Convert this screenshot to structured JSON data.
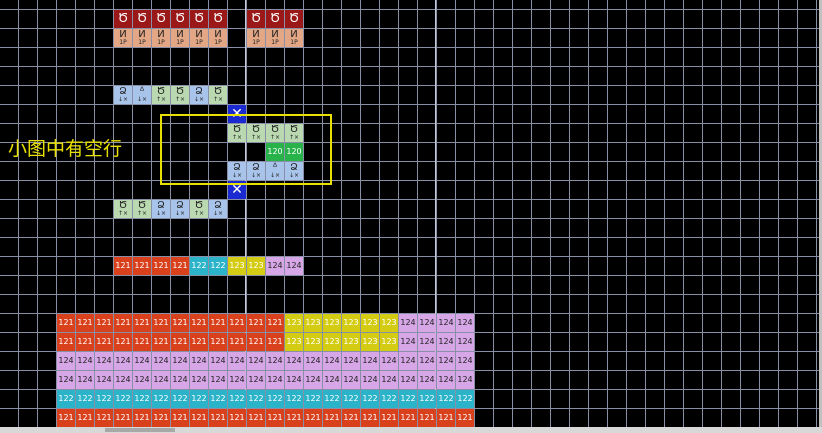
{
  "colors": {
    "grid_line": "#8a8fa8",
    "grid_major": "#c8ccd8",
    "c121": "#d9401c",
    "c122": "#2bb3c9",
    "c123": "#d4cc12",
    "c124": "#d6a6e6",
    "c120": "#27b34a",
    "dark_red": "#9a1818",
    "peach": "#e3a785",
    "light_blue": "#a9c4ea",
    "light_green": "#bad9b0",
    "blue_x": "#1a2ad0",
    "annotation": "#e8e000"
  },
  "annotation": {
    "text": "小图中有空行"
  },
  "top_row": {
    "top_glyph": "Ծ",
    "bottom_glyph": "Ͷ",
    "bottom_label": "1P",
    "columns": [
      12,
      13,
      14,
      15,
      16,
      17,
      19,
      20,
      21
    ]
  },
  "block_row1": {
    "cells": [
      {
        "col": 12,
        "glyph": "Ձ",
        "sub": "↓×",
        "color": "light_blue"
      },
      {
        "col": 13,
        "glyph": "ᐞ",
        "sub": "↓×",
        "color": "light_blue"
      },
      {
        "col": 14,
        "glyph": "Ծ",
        "sub": "↑×",
        "color": "light_green"
      },
      {
        "col": 15,
        "glyph": "Ծ",
        "sub": "↑×",
        "color": "light_green"
      },
      {
        "col": 16,
        "glyph": "Ձ",
        "sub": "↓×",
        "color": "light_blue"
      },
      {
        "col": 17,
        "glyph": "Ծ",
        "sub": "↑×",
        "color": "light_green"
      }
    ]
  },
  "block_row2": {
    "cells": [
      {
        "col": 18,
        "glyph": "Ծ",
        "sub": "↑×",
        "color": "light_green"
      },
      {
        "col": 19,
        "glyph": "Ծ",
        "sub": "↑×",
        "color": "light_green"
      },
      {
        "col": 20,
        "glyph": "Ծ",
        "sub": "↑×",
        "color": "light_green"
      },
      {
        "col": 21,
        "glyph": "Ծ",
        "sub": "↑×",
        "color": "light_green"
      }
    ]
  },
  "block_row3": {
    "cells": [
      {
        "col": 20,
        "value": "120",
        "color": "c120"
      },
      {
        "col": 21,
        "value": "120",
        "color": "c120"
      }
    ]
  },
  "block_row4": {
    "cells": [
      {
        "col": 18,
        "glyph": "Ձ",
        "sub": "↓×",
        "color": "light_blue"
      },
      {
        "col": 19,
        "glyph": "Ձ",
        "sub": "↓×",
        "color": "light_blue"
      },
      {
        "col": 20,
        "glyph": "ᐞ",
        "sub": "↓×",
        "color": "light_blue"
      },
      {
        "col": 21,
        "glyph": "Ձ",
        "sub": "↓×",
        "color": "light_blue"
      }
    ]
  },
  "block_row5": {
    "cells": [
      {
        "col": 12,
        "glyph": "Ծ",
        "sub": "↑×",
        "color": "light_green"
      },
      {
        "col": 13,
        "glyph": "Ծ",
        "sub": "↑×",
        "color": "light_green"
      },
      {
        "col": 14,
        "glyph": "Ձ",
        "sub": "↓×",
        "color": "light_blue"
      },
      {
        "col": 15,
        "glyph": "Ձ",
        "sub": "↓×",
        "color": "light_blue"
      },
      {
        "col": 16,
        "glyph": "Ծ",
        "sub": "↑×",
        "color": "light_green"
      },
      {
        "col": 17,
        "glyph": "Ձ",
        "sub": "↓×",
        "color": "light_blue"
      }
    ]
  },
  "blue_x_cells": [
    {
      "row": 5,
      "col": 18,
      "glyph": "✕"
    },
    {
      "row": 9,
      "col": 18,
      "glyph": "✕"
    }
  ],
  "summary_row": [
    "121",
    "121",
    "121",
    "121",
    "122",
    "122",
    "123",
    "123",
    "124",
    "124"
  ],
  "big_grid": [
    [
      "121",
      "121",
      "121",
      "121",
      "121",
      "121",
      "121",
      "121",
      "121",
      "121",
      "121",
      "121",
      "123",
      "123",
      "123",
      "123",
      "123",
      "123",
      "124",
      "124",
      "124",
      "124"
    ],
    [
      "121",
      "121",
      "121",
      "121",
      "121",
      "121",
      "121",
      "121",
      "121",
      "121",
      "121",
      "121",
      "123",
      "123",
      "123",
      "123",
      "123",
      "123",
      "124",
      "124",
      "124",
      "124"
    ],
    [
      "124",
      "124",
      "124",
      "124",
      "124",
      "124",
      "124",
      "124",
      "124",
      "124",
      "124",
      "124",
      "124",
      "124",
      "124",
      "124",
      "124",
      "124",
      "124",
      "124",
      "124",
      "124"
    ],
    [
      "124",
      "124",
      "124",
      "124",
      "124",
      "124",
      "124",
      "124",
      "124",
      "124",
      "124",
      "124",
      "124",
      "124",
      "124",
      "124",
      "124",
      "124",
      "124",
      "124",
      "124",
      "124"
    ],
    [
      "122",
      "122",
      "122",
      "122",
      "122",
      "122",
      "122",
      "122",
      "122",
      "122",
      "122",
      "122",
      "122",
      "122",
      "122",
      "122",
      "122",
      "122",
      "122",
      "122",
      "122",
      "122"
    ],
    [
      "121",
      "121",
      "121",
      "121",
      "121",
      "121",
      "121",
      "121",
      "121",
      "121",
      "121",
      "121",
      "121",
      "121",
      "121",
      "121",
      "121",
      "121",
      "121",
      "121",
      "121",
      "121"
    ]
  ]
}
